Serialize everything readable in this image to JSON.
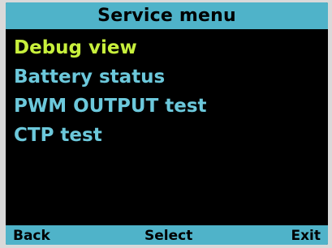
{
  "screen": {
    "title": "Service menu",
    "menu": {
      "items": [
        {
          "label": "Debug view",
          "selected": true
        },
        {
          "label": "Battery status",
          "selected": false
        },
        {
          "label": "PWM OUTPUT test",
          "selected": false
        },
        {
          "label": "CTP test",
          "selected": false
        }
      ]
    },
    "softkeys": {
      "back": "Back",
      "select": "Select",
      "exit": "Exit"
    }
  },
  "colors": {
    "background": "#000000",
    "bar": "#4fb3c9",
    "item_text": "#6cc8db",
    "selected_text": "#c8f03c"
  }
}
